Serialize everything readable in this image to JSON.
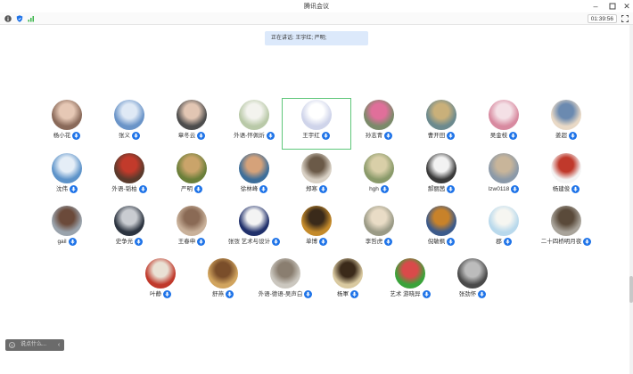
{
  "window": {
    "title": "腾讯会议"
  },
  "toolbar": {
    "timer": "01:39:56"
  },
  "speaking": {
    "text": "正在讲话: 王宇红; 严明;"
  },
  "participants": [
    {
      "name": "杨小花",
      "bg": "#8a6a5a",
      "accent": "#e6c8b5"
    },
    {
      "name": "张义",
      "bg": "#6a94c8",
      "accent": "#dfe9f5"
    },
    {
      "name": "章冬云",
      "bg": "#4d4d4d",
      "accent": "#e2c6b3"
    },
    {
      "name": "外语-怀佩炘",
      "bg": "#b9c9a8",
      "accent": "#f3f3ee"
    },
    {
      "name": "王宇红",
      "bg": "#cfd4ea",
      "accent": "#ffffff"
    },
    {
      "name": "孙志青",
      "bg": "#7b8a6a",
      "accent": "#e06f9a"
    },
    {
      "name": "曹开田",
      "bg": "#6c8a8e",
      "accent": "#c9b07a"
    },
    {
      "name": "吴金枝",
      "bg": "#d88aa0",
      "accent": "#f4e0e6"
    },
    {
      "name": "姜超",
      "bg": "#e9d9c6",
      "accent": "#6b8ab0"
    },
    {
      "name": "沈伟",
      "bg": "#5d93c9",
      "accent": "#e5eef7"
    },
    {
      "name": "外语-韬柏",
      "bg": "#5a3a2c",
      "accent": "#c23a2b"
    },
    {
      "name": "严明",
      "bg": "#6b7f3a",
      "accent": "#caa46a"
    },
    {
      "name": "徐林峰",
      "bg": "#3d6e9a",
      "accent": "#d5a27a"
    },
    {
      "name": "郑寒",
      "bg": "#d8d0c4",
      "accent": "#6b5a48"
    },
    {
      "name": "hgh",
      "bg": "#8a9a6a",
      "accent": "#d9cfa8"
    },
    {
      "name": "郝丽茜",
      "bg": "#3a3a3a",
      "accent": "#f2f2f2"
    },
    {
      "name": "lzw0118",
      "bg": "#8b99a8",
      "accent": "#c8b59a"
    },
    {
      "name": "杨建俊",
      "bg": "#f4f4f4",
      "accent": "#c0392b"
    },
    {
      "name": "gail",
      "bg": "#9aa3ac",
      "accent": "#6b4a3a"
    },
    {
      "name": "史争光",
      "bg": "#2c3440",
      "accent": "#c9ccd1"
    },
    {
      "name": "王春申",
      "bg": "#c9b19a",
      "accent": "#8a6a55"
    },
    {
      "name": "张弢 艺术与设计",
      "bg": "#20306b",
      "accent": "#f3f3f3"
    },
    {
      "name": "单博",
      "bg": "#c48a2a",
      "accent": "#3a2a1a"
    },
    {
      "name": "李哲虎",
      "bg": "#9a9a86",
      "accent": "#e9dcc6"
    },
    {
      "name": "倪敏枫",
      "bg": "#3c5a8a",
      "accent": "#c8822a"
    },
    {
      "name": "郡",
      "bg": "#b9d9ec",
      "accent": "#f6f6f1"
    },
    {
      "name": "二十四桥明月夜",
      "bg": "#a8a39a",
      "accent": "#5a4a3a"
    },
    {
      "name": "叶静",
      "bg": "#c0392b",
      "accent": "#e9e1d4"
    },
    {
      "name": "舒燕",
      "bg": "#d1a45e",
      "accent": "#7a4e2a"
    },
    {
      "name": "外语-德语-吴声白",
      "bg": "#cbc7bf",
      "accent": "#8a7e70"
    },
    {
      "name": "杨軍",
      "bg": "#d9c9a0",
      "accent": "#3b2a1a"
    },
    {
      "name": "艺术 游晓异",
      "bg": "#3aa33a",
      "accent": "#d94a4a"
    },
    {
      "name": "张劲怀",
      "bg": "#4a4a4a",
      "accent": "#bcbcbc"
    }
  ],
  "chat": {
    "placeholder": "说点什么..."
  },
  "colors": {
    "accent": "#1e73e8",
    "active_border": "#5ec77a",
    "speaking_bg": "#dce9fb"
  }
}
